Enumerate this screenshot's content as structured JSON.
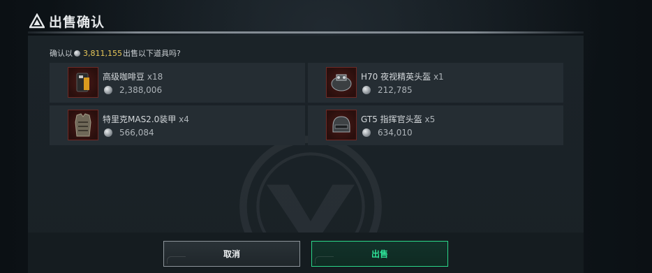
{
  "dialog": {
    "title": "出售确认",
    "confirm_prefix": "确认以",
    "total": "3,811,155",
    "confirm_suffix": "出售以下道具吗?"
  },
  "items": [
    {
      "name": "高级咖啡豆",
      "qty": "x18",
      "price": "2,388,006",
      "icon": "coffee-bean-bag-icon"
    },
    {
      "name": "H70 夜视精英头盔",
      "qty": "x1",
      "price": "212,785",
      "icon": "night-vision-helmet-icon"
    },
    {
      "name": "特里克MAS2.0装甲",
      "qty": "x4",
      "price": "566,084",
      "icon": "body-armor-icon"
    },
    {
      "name": "GT5 指挥官头盔",
      "qty": "x5",
      "price": "634,010",
      "icon": "commander-helmet-icon"
    }
  ],
  "buttons": {
    "cancel": "取消",
    "sell": "出售"
  },
  "colors": {
    "accent_green": "#2ee69a",
    "price_gold": "#e8c85a",
    "item_frame_red": "#6e2a26"
  }
}
